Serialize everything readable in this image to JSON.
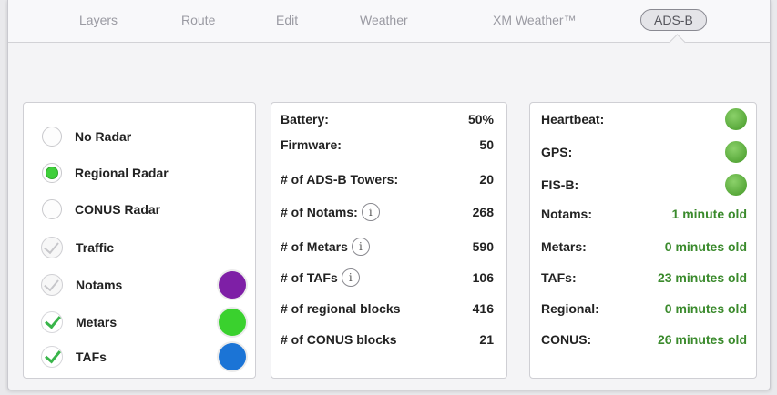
{
  "tabs": [
    {
      "label": "Layers"
    },
    {
      "label": "Route"
    },
    {
      "label": "Edit"
    },
    {
      "label": "Weather"
    },
    {
      "label": "XM Weather™"
    },
    {
      "label": "ADS-B",
      "active": true
    }
  ],
  "layers": {
    "radio_options": [
      {
        "label": "No Radar",
        "selected": false
      },
      {
        "label": "Regional Radar",
        "selected": true
      },
      {
        "label": "CONUS Radar",
        "selected": false
      }
    ],
    "toggles": [
      {
        "label": "Traffic",
        "checked": false,
        "color": null
      },
      {
        "label": "Notams",
        "checked": false,
        "color": "#7e1fa6"
      },
      {
        "label": "Metars",
        "checked": true,
        "color": "#3ad12e"
      },
      {
        "label": "TAFs",
        "checked": true,
        "color": "#1b74d6"
      }
    ]
  },
  "stats": [
    {
      "label": "Battery:",
      "value": "50%",
      "info": false
    },
    {
      "label": "Firmware:",
      "value": "50",
      "info": false
    },
    {
      "label": "# of ADS-B Towers:",
      "value": "20",
      "info": false
    },
    {
      "label": "# of Notams:",
      "value": "268",
      "info": true
    },
    {
      "label": "# of Metars",
      "value": "590",
      "info": true
    },
    {
      "label": "# of TAFs",
      "value": "106",
      "info": true
    },
    {
      "label": "# of regional blocks",
      "value": "416",
      "info": false
    },
    {
      "label": "# of CONUS blocks",
      "value": "21",
      "info": false
    }
  ],
  "info_glyph": "i",
  "status": [
    {
      "label": "Heartbeat:",
      "indicator": "green-led"
    },
    {
      "label": "GPS:",
      "indicator": "green-led"
    },
    {
      "label": "FIS-B:",
      "indicator": "green-led"
    },
    {
      "label": "Notams:",
      "age": "1 minute old"
    },
    {
      "label": "Metars:",
      "age": "0 minutes old"
    },
    {
      "label": "TAFs:",
      "age": "23 minutes old"
    },
    {
      "label": "Regional:",
      "age": "0 minutes old"
    },
    {
      "label": "CONUS:",
      "age": "26 minutes old"
    }
  ]
}
